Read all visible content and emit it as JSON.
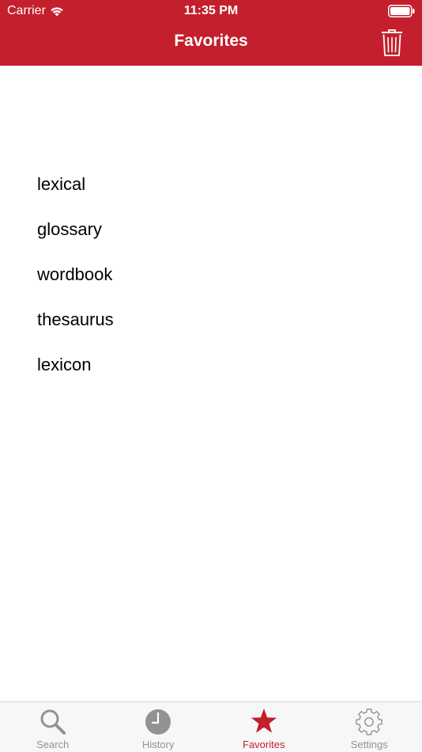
{
  "status_bar": {
    "carrier": "Carrier",
    "time": "11:35 PM"
  },
  "nav": {
    "title": "Favorites",
    "action_icon": "trash-icon"
  },
  "favorites": [
    "lexical",
    "glossary",
    "wordbook",
    "thesaurus",
    "lexicon"
  ],
  "tabbar": {
    "tabs": [
      {
        "label": "Search",
        "icon": "magnifier-icon",
        "active": false
      },
      {
        "label": "History",
        "icon": "clock-icon",
        "active": false
      },
      {
        "label": "Favorites",
        "icon": "star-icon",
        "active": true
      },
      {
        "label": "Settings",
        "icon": "gear-icon",
        "active": false
      }
    ]
  },
  "colors": {
    "accent": "#c41f2c",
    "inactive": "#929292",
    "tabbar_bg": "#f7f7f7"
  }
}
